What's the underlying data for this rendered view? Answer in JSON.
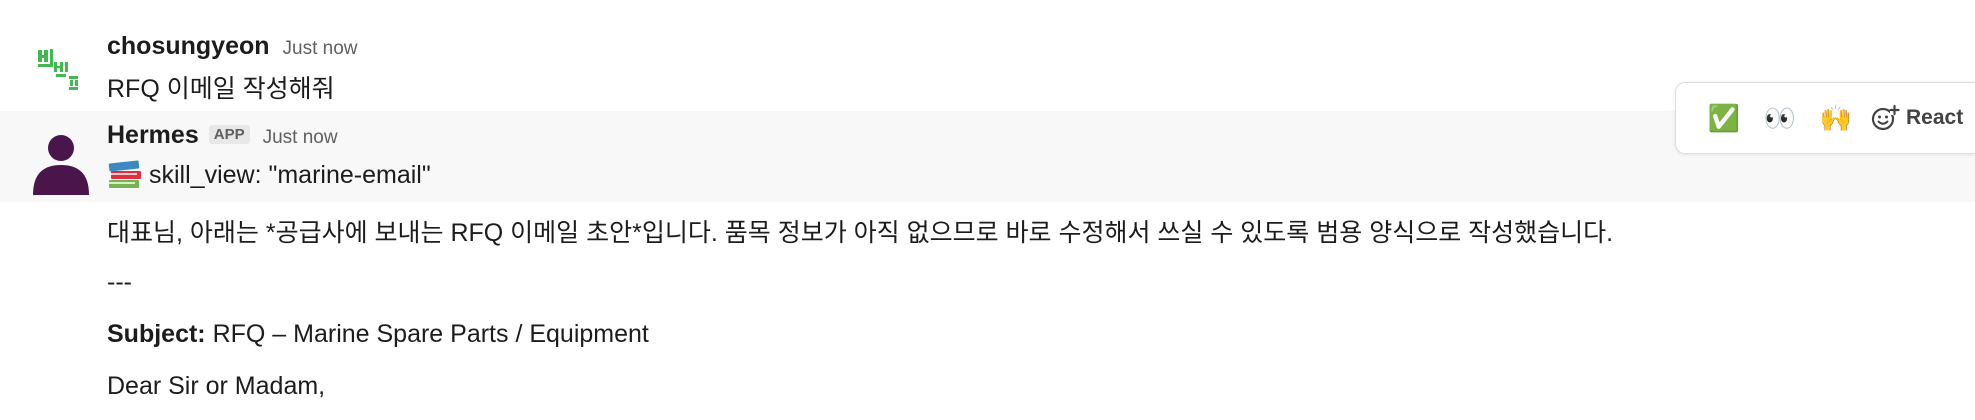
{
  "messages": {
    "user": {
      "author": "chosungyeon",
      "timestamp": "Just now",
      "text": "RFQ 이메일 작성해줘"
    },
    "bot": {
      "author": "Hermes",
      "badge": "APP",
      "timestamp": "Just now",
      "tool_call": "skill_view: \"marine-email\""
    }
  },
  "reactions": {
    "quick": [
      {
        "name": "white-check-mark",
        "glyph": "✅"
      },
      {
        "name": "eyes",
        "glyph": "👀"
      },
      {
        "name": "raised-hands",
        "glyph": "🙌"
      }
    ],
    "add_label": "React"
  },
  "body": {
    "intro": "대표님, 아래는 *공급사에 보내는 RFQ 이메일 초안*입니다. 품목 정보가 아직 없으므로 바로 수정해서 쓰실 수 있도록 범용 양식으로 작성했습니다.",
    "divider": "---",
    "subject_label": "Subject:",
    "subject_value": " RFQ – Marine Spare Parts / Equipment",
    "greeting": "Dear Sir or Madam,"
  },
  "colors": {
    "avatar_user": "#3fb950",
    "avatar_bot": "#4a154b",
    "bot_row_bg": "#f8f8f8"
  }
}
